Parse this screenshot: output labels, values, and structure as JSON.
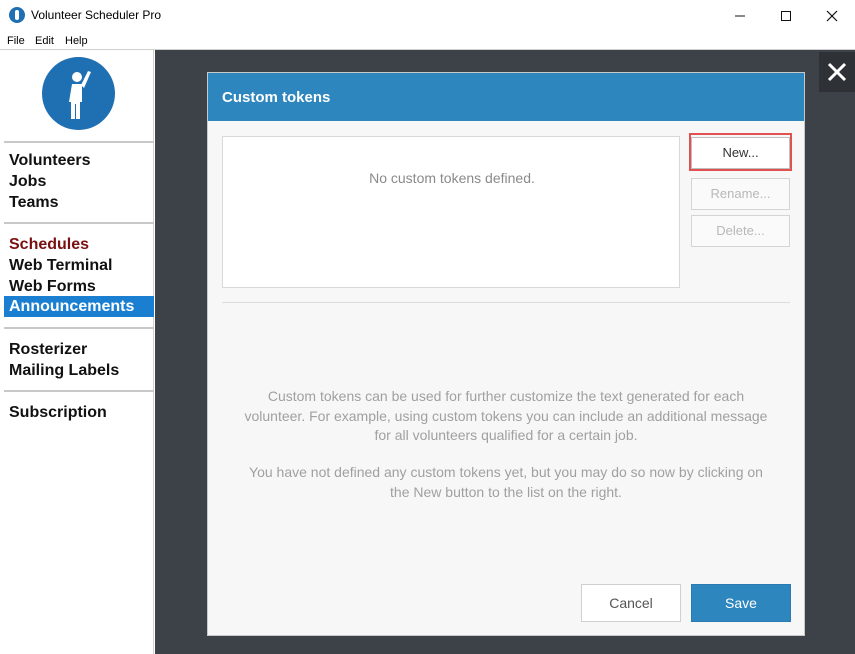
{
  "window": {
    "title": "Volunteer Scheduler Pro",
    "icon": "app-logo-icon"
  },
  "menu": [
    "File",
    "Edit",
    "Help"
  ],
  "sidebar": {
    "groups": [
      [
        "Volunteers",
        "Jobs",
        "Teams"
      ],
      [
        "Schedules",
        "Web Terminal",
        "Web Forms",
        "Announcements"
      ],
      [
        "Rosterizer",
        "Mailing Labels"
      ],
      [
        "Subscription"
      ]
    ],
    "active": "Announcements",
    "highlighted": "Schedules"
  },
  "dialog": {
    "title": "Custom tokens",
    "empty_message": "No custom tokens defined.",
    "buttons": {
      "new": "New...",
      "rename": "Rename...",
      "delete": "Delete..."
    },
    "help_text_1": "Custom tokens can be used for further customize the text generated for each volunteer. For example, using custom tokens you can include an additional message for all volunteers qualified for a certain job.",
    "help_text_2": "You have not defined any custom tokens yet, but you may do so now by clicking on the New button to the list on the right.",
    "cancel": "Cancel",
    "save": "Save"
  },
  "colors": {
    "accent": "#2e86bf",
    "nav_active": "#1a7fd1",
    "nav_red": "#7a1010",
    "highlight": "#e0514f"
  }
}
